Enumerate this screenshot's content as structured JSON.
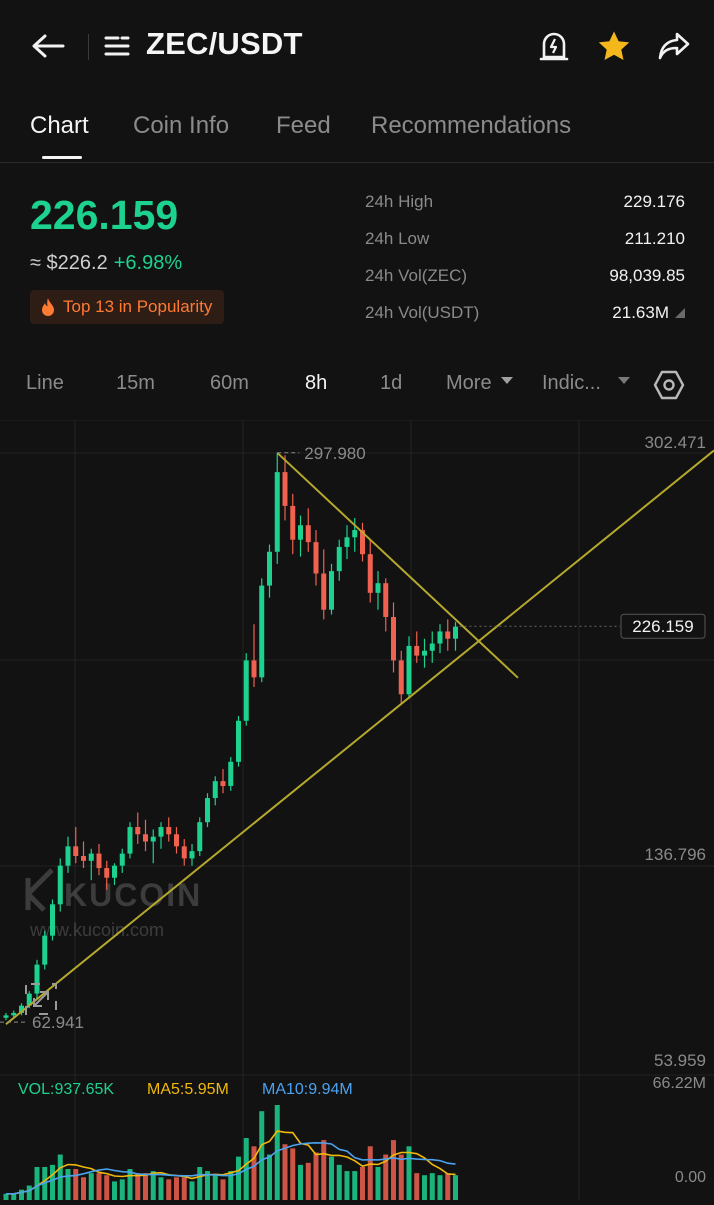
{
  "header": {
    "pair": "ZEC/USDT"
  },
  "tabs": [
    {
      "label": "Chart"
    },
    {
      "label": "Coin Info"
    },
    {
      "label": "Feed"
    },
    {
      "label": "Recommendations"
    }
  ],
  "ticker": {
    "price": "226.159",
    "fiat": "≈ $226.2",
    "change": "+6.98%",
    "popularity": "Top 13 in Popularity"
  },
  "stats": [
    {
      "label": "24h High",
      "value": "229.176"
    },
    {
      "label": "24h Low",
      "value": "211.210"
    },
    {
      "label": "24h Vol(ZEC)",
      "value": "98,039.85"
    },
    {
      "label": "24h Vol(USDT)",
      "value": "21.63M"
    }
  ],
  "intervals": [
    {
      "label": "Line"
    },
    {
      "label": "15m"
    },
    {
      "label": "60m"
    },
    {
      "label": "8h"
    },
    {
      "label": "1d"
    },
    {
      "label": "More"
    },
    {
      "label": "Indic..."
    }
  ],
  "colors": {
    "up": "#1dd18f",
    "down": "#f0614f",
    "trendline": "#b5a82c",
    "ma5": "#f0b90b",
    "ma10": "#4ba3f0"
  },
  "chart_data": {
    "type": "candlestick",
    "price_axis_labels": [
      "302.471",
      "226.159",
      "136.796",
      "53.959"
    ],
    "high_label": "297.980",
    "low_label": "62.941",
    "current_price_tag": "226.159",
    "watermark": "KUCOIN",
    "watermark_url": "www.kucoin.com",
    "volume_legend": {
      "vol": "VOL:937.65K",
      "ma5": "MA5:5.95M",
      "ma10": "MA10:9.94M"
    },
    "volume_axis_labels": [
      "66.22M",
      "0.00"
    ],
    "ylim": [
      53.959,
      302.471
    ],
    "candles": [
      [
        64,
        66,
        63,
        65
      ],
      [
        65,
        67,
        64,
        66
      ],
      [
        66,
        70,
        65,
        69
      ],
      [
        69,
        75,
        68,
        74
      ],
      [
        74,
        88,
        72,
        86
      ],
      [
        86,
        100,
        84,
        98
      ],
      [
        98,
        113,
        96,
        111
      ],
      [
        111,
        130,
        108,
        127
      ],
      [
        127,
        139,
        124,
        135
      ],
      [
        135,
        143,
        128,
        131
      ],
      [
        131,
        137,
        126,
        129
      ],
      [
        129,
        134,
        121,
        132
      ],
      [
        132,
        136,
        123,
        126
      ],
      [
        126,
        129,
        117,
        122
      ],
      [
        122,
        128,
        119,
        127
      ],
      [
        127,
        134,
        124,
        132
      ],
      [
        132,
        145,
        130,
        143
      ],
      [
        143,
        149,
        136,
        140
      ],
      [
        140,
        146,
        133,
        137
      ],
      [
        137,
        142,
        128,
        139
      ],
      [
        139,
        145,
        134,
        143
      ],
      [
        143,
        147,
        137,
        140
      ],
      [
        140,
        143,
        132,
        135
      ],
      [
        135,
        138,
        127,
        130
      ],
      [
        130,
        136,
        127,
        133
      ],
      [
        133,
        147,
        131,
        145
      ],
      [
        145,
        157,
        143,
        155
      ],
      [
        155,
        164,
        152,
        162
      ],
      [
        162,
        167,
        157,
        160
      ],
      [
        160,
        172,
        158,
        170
      ],
      [
        170,
        189,
        168,
        187
      ],
      [
        187,
        215,
        185,
        212
      ],
      [
        212,
        227,
        201,
        205
      ],
      [
        205,
        246,
        203,
        243
      ],
      [
        243,
        260,
        238,
        257
      ],
      [
        257,
        298,
        252,
        290
      ],
      [
        290,
        297,
        270,
        276
      ],
      [
        276,
        281,
        256,
        262
      ],
      [
        262,
        272,
        255,
        268
      ],
      [
        268,
        275,
        257,
        261
      ],
      [
        261,
        266,
        243,
        248
      ],
      [
        248,
        258,
        229,
        233
      ],
      [
        233,
        252,
        231,
        249
      ],
      [
        249,
        262,
        245,
        259
      ],
      [
        259,
        268,
        254,
        263
      ],
      [
        263,
        271,
        257,
        266
      ],
      [
        266,
        269,
        253,
        256
      ],
      [
        256,
        262,
        236,
        240
      ],
      [
        240,
        249,
        233,
        244
      ],
      [
        244,
        246,
        224,
        230
      ],
      [
        230,
        236,
        207,
        212
      ],
      [
        212,
        216,
        194,
        198
      ],
      [
        198,
        222,
        196,
        218
      ],
      [
        218,
        224,
        211,
        214
      ],
      [
        214,
        221,
        209,
        216
      ],
      [
        216,
        224,
        211,
        219
      ],
      [
        219,
        227,
        215,
        224
      ],
      [
        224,
        229,
        216,
        221
      ],
      [
        221,
        228,
        216,
        226
      ]
    ]
  }
}
